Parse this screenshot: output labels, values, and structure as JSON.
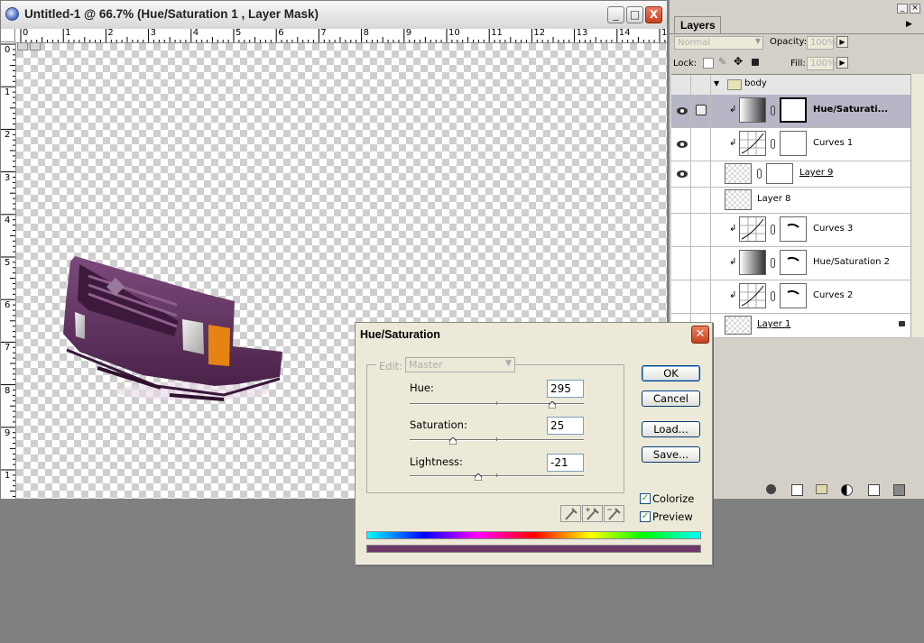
{
  "document": {
    "title": "Untitled-1 @ 66.7% (Hue/Saturation 1 , Layer Mask)",
    "controls": {
      "minimize": "_",
      "maximize": "□",
      "close": "X"
    },
    "hruler_numbers": [
      "0",
      "1",
      "2",
      "3",
      "4",
      "5",
      "6",
      "7",
      "8",
      "9",
      "10",
      "11",
      "12",
      "13",
      "14",
      "15"
    ],
    "vruler_numbers": [
      "0",
      "1",
      "2",
      "3",
      "4",
      "5",
      "6",
      "7",
      "8",
      "9",
      "1"
    ]
  },
  "layers_panel": {
    "tab": "Layers",
    "blend_mode": "Normal",
    "opacity_label": "Opacity:",
    "opacity_value": "100%",
    "lock_label": "Lock:",
    "fill_label": "Fill:",
    "fill_value": "100%",
    "group_name": "body",
    "layers": [
      {
        "name": "Hue/Saturati...",
        "visible": true,
        "selected": true,
        "clipped": true
      },
      {
        "name": "Curves 1",
        "visible": true,
        "selected": false,
        "clipped": true
      },
      {
        "name": "Layer 9",
        "visible": true,
        "selected": false,
        "clipped": false
      },
      {
        "name": "Layer 8",
        "visible": false,
        "selected": false,
        "clipped": false
      },
      {
        "name": "Curves 3",
        "visible": false,
        "selected": false,
        "clipped": true
      },
      {
        "name": "Hue/Saturation 2",
        "visible": false,
        "selected": false,
        "clipped": true
      },
      {
        "name": "Curves 2",
        "visible": false,
        "selected": false,
        "clipped": true
      },
      {
        "name": "Layer 1",
        "visible": false,
        "selected": false,
        "clipped": false
      }
    ]
  },
  "hue_saturation": {
    "title": "Hue/Saturation",
    "edit_label": "Edit:",
    "edit_value": "Master",
    "hue_label": "Hue:",
    "hue_value": "295",
    "saturation_label": "Saturation:",
    "saturation_value": "25",
    "lightness_label": "Lightness:",
    "lightness_value": "-21",
    "ok": "OK",
    "cancel": "Cancel",
    "load": "Load...",
    "save": "Save...",
    "colorize_label": "Colorize",
    "colorize_checked": true,
    "preview_label": "Preview",
    "preview_checked": true,
    "result_color": "#6e3a6b"
  }
}
